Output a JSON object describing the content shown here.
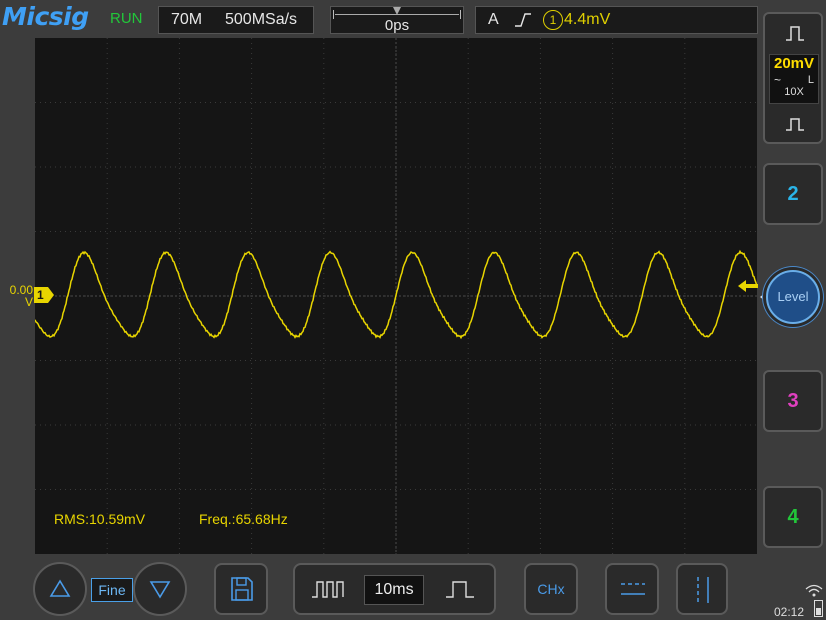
{
  "app": {
    "logo": "Micsig",
    "run_status": "RUN"
  },
  "acquisition": {
    "bandwidth": "70M",
    "sample_rate": "500MSa/s"
  },
  "horizontal": {
    "trigger_position": "0ps",
    "timebase": "10ms"
  },
  "trigger": {
    "mode": "A",
    "edge_icon": "rising-edge-icon",
    "source": "1",
    "level": "4.4mV",
    "knob_label": "Level"
  },
  "channel1": {
    "offset_label": "0.00",
    "offset_unit": "V",
    "marker": "1",
    "vdiv": "20mV",
    "coupling_icon": "~",
    "bw_limit": "L",
    "probe": "10X",
    "color": "#e8d500"
  },
  "channels": {
    "ch2": "2",
    "ch3": "3",
    "ch4": "4",
    "ch2_color": "#2ab4e8",
    "ch3_color": "#e040c0",
    "ch4_color": "#22c73a"
  },
  "measurements": {
    "rms": "RMS:10.59mV",
    "freq": "Freq.:65.68Hz"
  },
  "toolbar": {
    "fine_label": "Fine",
    "chx_label": "CHx"
  },
  "status": {
    "time": "02:12"
  },
  "waveform": {
    "description_units": "cycles across screen",
    "cycles": 8.8,
    "amplitude_div": 0.8,
    "phase": 0.62
  }
}
